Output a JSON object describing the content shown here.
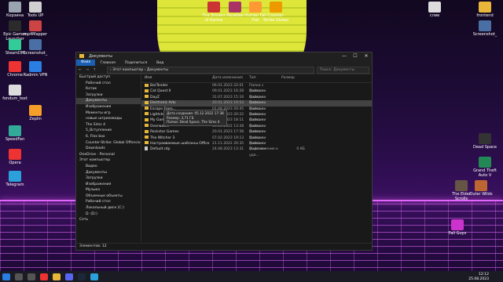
{
  "desktop_icons": [
    {
      "label": "Корзина",
      "icon": "recycle-bin",
      "color": "#9aa4b0"
    },
    {
      "label": "Tools UP",
      "icon": "app",
      "color": "#d0d0d0"
    },
    {
      "label": "Epic Games Launcher",
      "icon": "epic",
      "color": "#2b2b2b"
    },
    {
      "label": "mp4Mapper",
      "icon": "app",
      "color": "#c44"
    },
    {
      "label": "Screenshot_",
      "icon": "image",
      "color": "#4a6fa5"
    },
    {
      "label": "SteamDM",
      "icon": "app",
      "color": "#3c9"
    },
    {
      "label": "Chrome",
      "icon": "chrome",
      "color": "#e33"
    },
    {
      "label": "Radmin VPN",
      "icon": "vpn",
      "color": "#2a7de1"
    },
    {
      "label": "fondum_text",
      "icon": "file",
      "color": "#ddd"
    },
    {
      "label": "Zeplin",
      "icon": "app",
      "color": "#f59f2a"
    },
    {
      "label": "SpeedFan",
      "icon": "fan",
      "color": "#3a9"
    },
    {
      "label": "Opera",
      "icon": "opera",
      "color": "#e33"
    },
    {
      "label": "Telegram",
      "icon": "app",
      "color": "#2aa1da"
    },
    {
      "label": "The Sinners of Karma",
      "icon": "game",
      "color": "#c33"
    },
    {
      "label": "Paradise",
      "icon": "game",
      "color": "#a36"
    },
    {
      "label": "Human Fall Flat",
      "icon": "game",
      "color": "#f93"
    },
    {
      "label": "Counter-Strike Global",
      "icon": "game",
      "color": "#e90"
    },
    {
      "label": "слив",
      "icon": "file",
      "color": "#ddd"
    },
    {
      "label": "frontend",
      "icon": "folder",
      "color": "#e8b73a"
    },
    {
      "label": "Screenshot_",
      "icon": "image",
      "color": "#4a6fa5"
    },
    {
      "label": "Dead Space",
      "icon": "game",
      "color": "#333"
    },
    {
      "label": "Grand Theft Auto V",
      "icon": "game",
      "color": "#285"
    },
    {
      "label": "The Elder Scrolls",
      "icon": "game",
      "color": "#654"
    },
    {
      "label": "Outer Wilds",
      "icon": "game",
      "color": "#b63"
    },
    {
      "label": "Fall Guys",
      "icon": "game",
      "color": "#c3c"
    }
  ],
  "window": {
    "title": "Документы",
    "controls": {
      "min": "—",
      "max": "☐",
      "close": "✕"
    },
    "ribbon": [
      "Файл",
      "Главная",
      "Поделиться",
      "Вид"
    ],
    "nav_arrows": "← → ↑",
    "path": "› Этот компьютер › Документы",
    "search_placeholder": "Поиск: Документы",
    "sidebar": [
      {
        "label": "Быстрый доступ",
        "top": true
      },
      {
        "label": "Рабочий стол"
      },
      {
        "label": "Котик"
      },
      {
        "label": "Загрузки"
      },
      {
        "label": "Документы",
        "selected": true
      },
      {
        "label": "Изображения"
      },
      {
        "label": "Моменты игр"
      },
      {
        "label": "новые штриховоды"
      },
      {
        "label": "The Sims 4"
      },
      {
        "label": "5_Вступление"
      },
      {
        "label": "6. Flex box"
      },
      {
        "label": "Counter-Strike: Global Offensive"
      },
      {
        "label": "Downloads"
      },
      {
        "label": "OneDrive - Personal",
        "top": true
      },
      {
        "label": "Этот компьютер",
        "top": true
      },
      {
        "label": "Видео"
      },
      {
        "label": "Документы"
      },
      {
        "label": "Загрузки"
      },
      {
        "label": "Изображения"
      },
      {
        "label": "Музыка"
      },
      {
        "label": "Объемные объекты"
      },
      {
        "label": "Рабочий стол"
      },
      {
        "label": "Локальный диск (C:)"
      },
      {
        "label": "D: (D:)"
      },
      {
        "label": "Сеть",
        "top": true
      }
    ],
    "columns": [
      "Имя",
      "Дата изменения",
      "Тип",
      "Размер"
    ],
    "files": [
      {
        "name": "BarTender",
        "date": "06.01.2023 22:01",
        "type": "Папка с файлами",
        "size": "",
        "kind": "folder"
      },
      {
        "name": "Cat Quest II",
        "date": "09.01.2023 16:28",
        "type": "Папка с файлами",
        "size": "",
        "kind": "folder"
      },
      {
        "name": "DayZ",
        "date": "31.07.2023 15:16",
        "type": "Папка с файлами",
        "size": "",
        "kind": "folder"
      },
      {
        "name": "Electronic Arts",
        "date": "20.01.2023 19:53",
        "type": "Папка с файлами",
        "size": "",
        "kind": "folder",
        "selected": true
      },
      {
        "name": "Escape From...",
        "date": "01.08.2023 20:45",
        "type": "Папка с файлами",
        "size": "",
        "kind": "folder"
      },
      {
        "name": "Lightshot",
        "date": "03.08.2023 20:22",
        "type": "Папка с файлами",
        "size": "",
        "kind": "folder"
      },
      {
        "name": "My Games",
        "date": "28.07.2023 18:11",
        "type": "Папка с файлами",
        "size": "",
        "kind": "folder"
      },
      {
        "name": "Overwatch",
        "date": "13.10.2022 13:28",
        "type": "Папка с файлами",
        "size": "",
        "kind": "folder"
      },
      {
        "name": "Rockstar Games",
        "date": "20.01.2023 17:58",
        "type": "Папка с файлами",
        "size": "",
        "kind": "folder"
      },
      {
        "name": "The Witcher 3",
        "date": "07.02.2023 19:13",
        "type": "Папка с файлами",
        "size": "",
        "kind": "folder"
      },
      {
        "name": "Настраиваемые шаблоны Office",
        "date": "21.11.2022 20:35",
        "type": "Папка с файлами",
        "size": "",
        "kind": "folder"
      },
      {
        "name": "Default.rdp",
        "date": "24.08.2023 13:31",
        "type": "Подключение к уда...",
        "size": "0 КБ",
        "kind": "file"
      }
    ],
    "tooltip": [
      "Дата создания: 05.12.2022 17:38",
      "Размер: 3,71 ГБ",
      "Папки: Dead Space, The Sims 4"
    ],
    "status": "Элементов: 12"
  },
  "taskbar": {
    "time": "12:12",
    "date": "25.08.2023"
  }
}
